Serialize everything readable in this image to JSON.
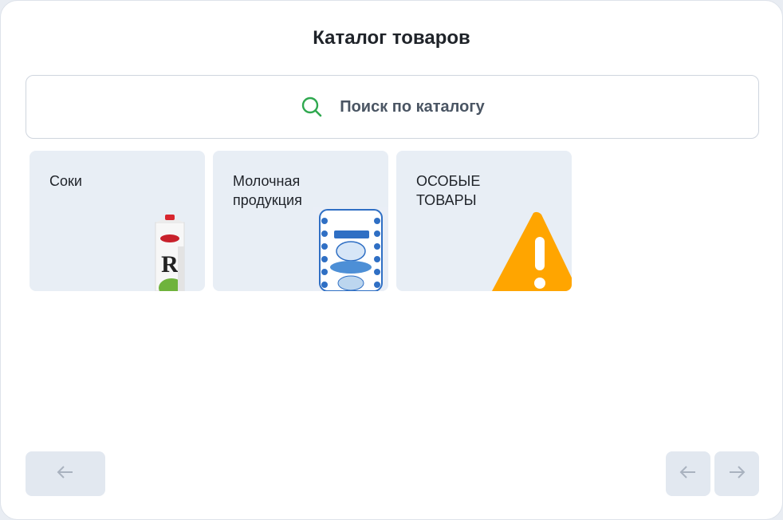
{
  "header": {
    "title": "Каталог товаров"
  },
  "search": {
    "placeholder": "Поиск по каталогу"
  },
  "categories": [
    {
      "label": "Соки",
      "icon": "juice-carton-image"
    },
    {
      "label": "Молочная продукция",
      "icon": "milk-pack-image"
    },
    {
      "label": "ОСОБЫЕ ТОВАРЫ",
      "icon": "warning-icon"
    }
  ],
  "navigation": {
    "back_icon": "arrow-left-icon",
    "prev_icon": "arrow-left-icon",
    "next_icon": "arrow-right-icon"
  },
  "colors": {
    "accent_green": "#2fa84f",
    "tile_background": "#e8eef5",
    "button_background": "#e2e8f0",
    "warning_orange": "#ffa500",
    "icon_gray": "#a9b2bf"
  }
}
